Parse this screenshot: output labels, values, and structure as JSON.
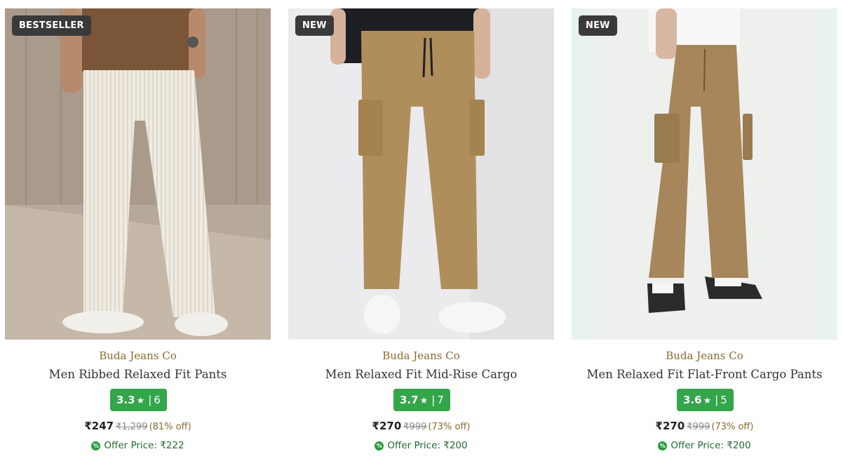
{
  "products": [
    {
      "badge": "BESTSELLER",
      "brand": "Buda Jeans Co",
      "title": "Men Ribbed Relaxed Fit Pants",
      "rating": "3.3",
      "rating_count": "6",
      "price": "₹247",
      "mrp": "₹1,299",
      "discount": "(81% off)",
      "offer_label": "Offer Price:",
      "offer_price": "₹222",
      "image_icon": "white-ribbed-pants-photo",
      "pants_color": "#efebe2"
    },
    {
      "badge": "NEW",
      "brand": "Buda Jeans Co",
      "title": "Men Relaxed Fit Mid-Rise Cargo",
      "rating": "3.7",
      "rating_count": "7",
      "price": "₹270",
      "mrp": "₹999",
      "discount": "(73% off)",
      "offer_label": "Offer Price:",
      "offer_price": "₹200",
      "image_icon": "khaki-cargo-pants-photo",
      "pants_color": "#b08e5c"
    },
    {
      "badge": "NEW",
      "brand": "Buda Jeans Co",
      "title": "Men Relaxed Fit Flat-Front Cargo Pants",
      "rating": "3.6",
      "rating_count": "5",
      "price": "₹270",
      "mrp": "₹999",
      "discount": "(73% off)",
      "offer_label": "Offer Price:",
      "offer_price": "₹200",
      "image_icon": "khaki-flat-front-cargo-pants-photo",
      "pants_color": "#a6865a"
    }
  ],
  "colors": {
    "brand_text": "#8a6a2c",
    "rating_bg": "#33a54a",
    "badge_bg": "#3a3a3a",
    "offer_text": "#226b2f"
  }
}
